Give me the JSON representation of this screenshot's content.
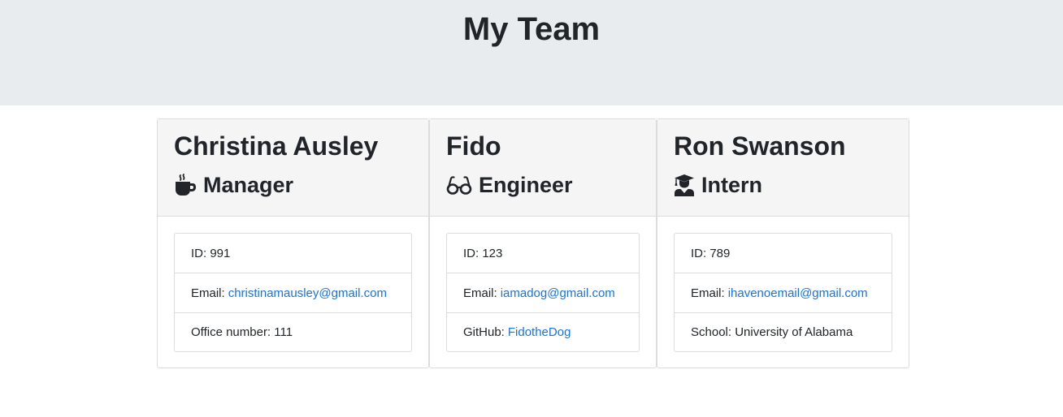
{
  "header": {
    "title": "My Team"
  },
  "team": [
    {
      "name": "Christina Ausley",
      "role": "Manager",
      "icon": "coffee-icon",
      "id_label": "ID:",
      "id": "991",
      "email_label": "Email:",
      "email": "christinamausley@gmail.com",
      "extra_label": "Office number:",
      "extra_value": "111"
    },
    {
      "name": "Fido",
      "role": "Engineer",
      "icon": "glasses-icon",
      "id_label": "ID:",
      "id": "123",
      "email_label": "Email:",
      "email": "iamadog@gmail.com",
      "extra_label": "GitHub:",
      "extra_value": "FidotheDog"
    },
    {
      "name": "Ron Swanson",
      "role": "Intern",
      "icon": "graduate-icon",
      "id_label": "ID:",
      "id": "789",
      "email_label": "Email:",
      "email": "ihavenoemail@gmail.com",
      "extra_label": "School:",
      "extra_value": "University of Alabama"
    }
  ],
  "colors": {
    "header_bg": "#e9ecef",
    "card_header_bg": "#f5f5f5",
    "link": "#1a73d9",
    "text": "#212529"
  }
}
